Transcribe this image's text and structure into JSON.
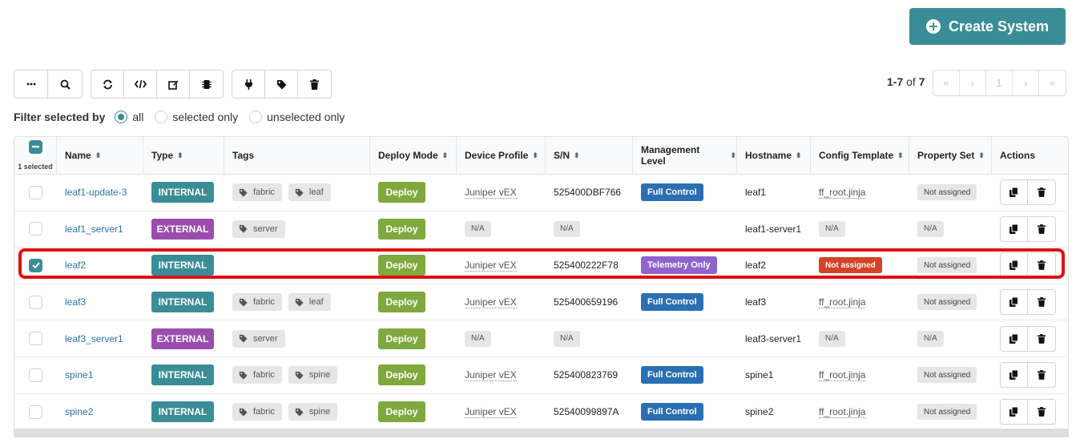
{
  "header": {
    "create_label": "Create System"
  },
  "toolbar": {
    "groups": [
      [
        "more-icon",
        "search-icon"
      ],
      [
        "refresh-icon",
        "code-icon",
        "edit-icon",
        "chip-icon"
      ],
      [
        "plug-icon",
        "tag-icon",
        "trash-icon"
      ]
    ]
  },
  "pagination": {
    "range": "1-7",
    "of_label": "of",
    "total": "7",
    "first": "«",
    "prev": "‹",
    "page": "1",
    "next": "›",
    "last": "»"
  },
  "filter": {
    "label": "Filter selected by",
    "options": [
      "all",
      "selected only",
      "unselected only"
    ],
    "selected": "all"
  },
  "table": {
    "selected_count": "1 selected",
    "columns": [
      "Name",
      "Type",
      "Tags",
      "Deploy Mode",
      "Device Profile",
      "S/N",
      "Management Level",
      "Hostname",
      "Config Template",
      "Property Set",
      "Actions"
    ],
    "rows": [
      {
        "checked": false,
        "name": "leaf1-update-3",
        "type": "INTERNAL",
        "tags": [
          "fabric",
          "leaf"
        ],
        "deploy": "Deploy",
        "profile": "Juniper vEX",
        "sn": "525400DBF766",
        "mgmt": "Full Control",
        "hostname": "leaf1",
        "template": "ff_root.jinja",
        "property": "Not assigned"
      },
      {
        "checked": false,
        "name": "leaf1_server1",
        "type": "EXTERNAL",
        "tags": [
          "server"
        ],
        "deploy": "Deploy",
        "profile": "N/A",
        "sn": "N/A",
        "mgmt": "",
        "hostname": "leaf1-server1",
        "template": "N/A",
        "property": "N/A"
      },
      {
        "checked": true,
        "name": "leaf2",
        "type": "INTERNAL",
        "tags": [],
        "deploy": "Deploy",
        "profile": "Juniper vEX",
        "sn": "525400222F78",
        "mgmt": "Telemetry Only",
        "hostname": "leaf2",
        "template": "Not assigned",
        "property": "Not assigned"
      },
      {
        "checked": false,
        "name": "leaf3",
        "type": "INTERNAL",
        "tags": [
          "fabric",
          "leaf"
        ],
        "deploy": "Deploy",
        "profile": "Juniper vEX",
        "sn": "525400659196",
        "mgmt": "Full Control",
        "hostname": "leaf3",
        "template": "ff_root.jinja",
        "property": "Not assigned"
      },
      {
        "checked": false,
        "name": "leaf3_server1",
        "type": "EXTERNAL",
        "tags": [
          "server"
        ],
        "deploy": "Deploy",
        "profile": "N/A",
        "sn": "N/A",
        "mgmt": "",
        "hostname": "leaf3-server1",
        "template": "N/A",
        "property": "N/A"
      },
      {
        "checked": false,
        "name": "spine1",
        "type": "INTERNAL",
        "tags": [
          "fabric",
          "spine"
        ],
        "deploy": "Deploy",
        "profile": "Juniper vEX",
        "sn": "525400823769",
        "mgmt": "Full Control",
        "hostname": "spine1",
        "template": "ff_root.jinja",
        "property": "Not assigned"
      },
      {
        "checked": false,
        "name": "spine2",
        "type": "INTERNAL",
        "tags": [
          "fabric",
          "spine"
        ],
        "deploy": "Deploy",
        "profile": "Juniper vEX",
        "sn": "52540099897A",
        "mgmt": "Full Control",
        "hostname": "spine2",
        "template": "ff_root.jinja",
        "property": "Not assigned"
      }
    ]
  },
  "colors": {
    "accent": "#3a8d96",
    "internal": "#3a8d96",
    "external": "#9b4dae",
    "deploy": "#7fa83f",
    "full_control": "#2a6fb3",
    "telemetry_only": "#8e63ce",
    "not_assigned_alert": "#d64227",
    "highlight": "#dd1111"
  }
}
